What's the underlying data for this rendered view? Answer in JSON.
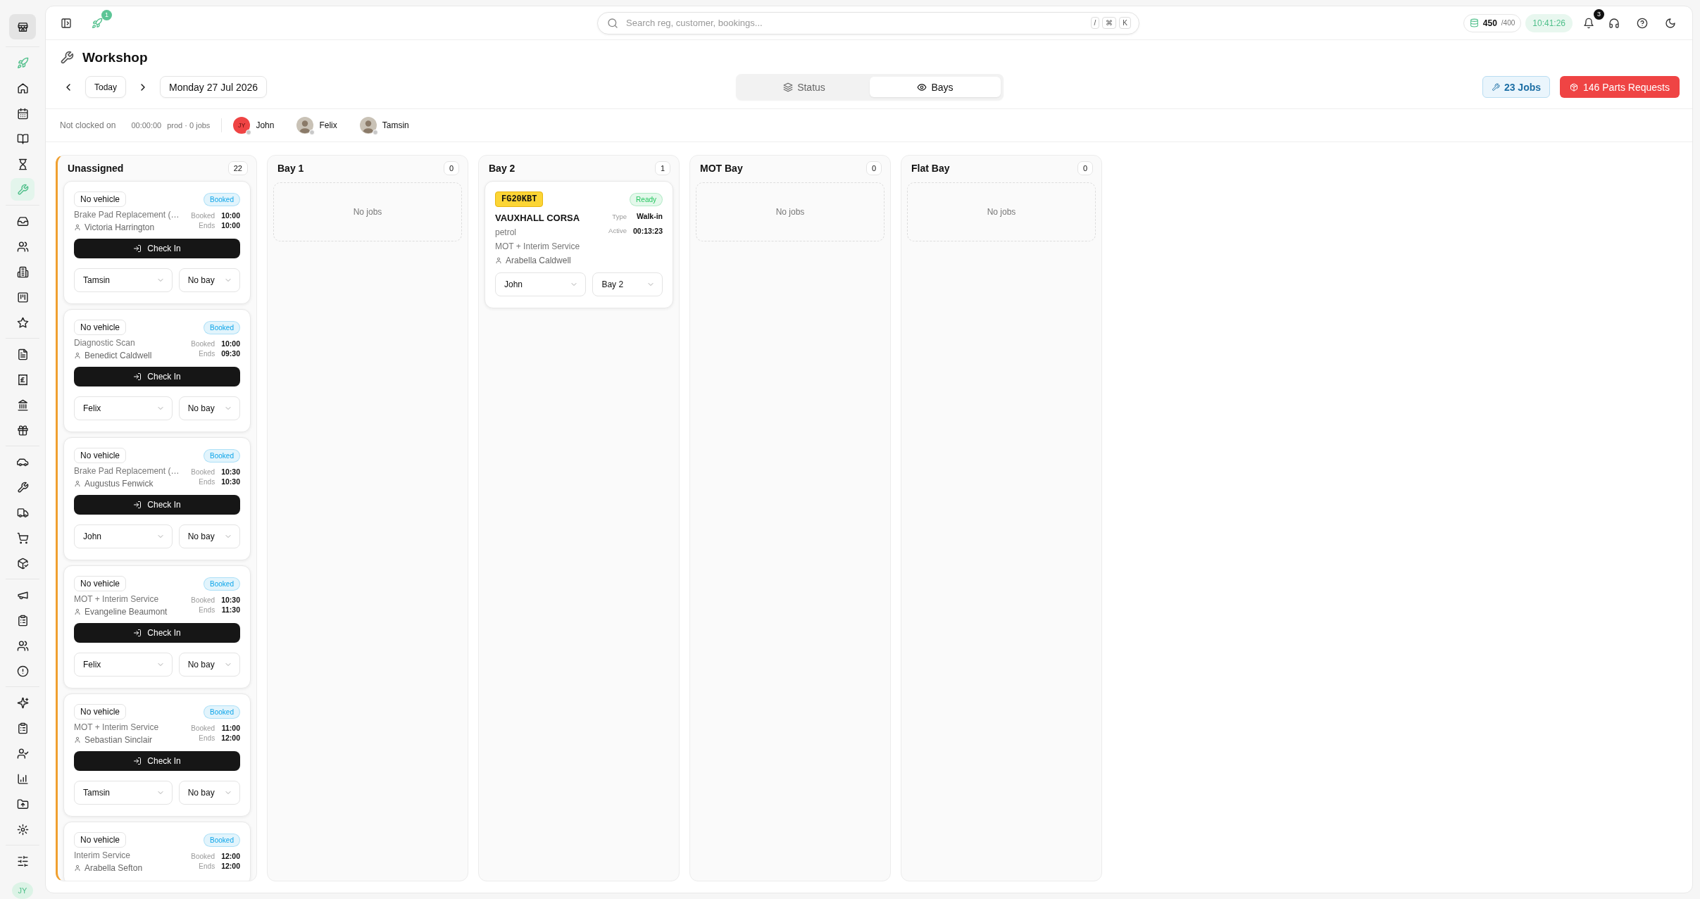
{
  "sidebar": {
    "groups": [
      [
        {
          "selected": false
        }
      ],
      [
        {
          "selected": false
        },
        {
          "selected": false
        },
        {
          "selected": false
        },
        {
          "selected": false
        },
        {
          "selected": false
        },
        {
          "selected": true
        }
      ],
      [
        {
          "selected": false
        },
        {
          "selected": false
        },
        {
          "selected": false
        },
        {
          "selected": false
        },
        {
          "selected": false
        }
      ],
      [
        {
          "selected": false
        },
        {
          "selected": false
        },
        {
          "selected": false
        },
        {
          "selected": false
        }
      ],
      [
        {
          "selected": false
        },
        {
          "selected": false
        },
        {
          "selected": false
        },
        {
          "selected": false
        },
        {
          "selected": false
        }
      ],
      [
        {
          "selected": false
        },
        {
          "selected": false
        },
        {
          "selected": false
        },
        {
          "selected": false
        }
      ],
      [
        {
          "selected": false
        },
        {
          "selected": false
        },
        {
          "selected": false
        },
        {
          "selected": false
        },
        {
          "selected": false
        },
        {
          "selected": false
        }
      ],
      [
        {
          "selected": false
        }
      ]
    ],
    "avatar": "JY"
  },
  "topbar": {
    "launch_badge": "1",
    "search": {
      "placeholder": "Search reg, customer, bookings...",
      "keys": [
        "/",
        "⌘",
        "K"
      ]
    },
    "credits": {
      "value": "450",
      "limit": "/400"
    },
    "clock": "10:41:26",
    "notification_badge": "3"
  },
  "page": {
    "title": "Workshop",
    "today_button": "Today",
    "date": "Monday 27 Jul 2026",
    "view_tabs": [
      {
        "label": "Status",
        "selected": false
      },
      {
        "label": "Bays",
        "selected": true
      }
    ],
    "jobs_button": "23 Jobs",
    "parts_button": "146 Parts Requests"
  },
  "clock_status": {
    "label": "Not clocked on",
    "time": "00:00:00",
    "summary": "prod · 0 jobs"
  },
  "technicians": [
    {
      "name": "John",
      "kind": "initials",
      "initials": "JY",
      "online": false
    },
    {
      "name": "Felix",
      "kind": "photo",
      "online": false
    },
    {
      "name": "Tamsin",
      "kind": "photo",
      "online": false
    }
  ],
  "columns": [
    {
      "title": "Unassigned",
      "count": "22",
      "highlighted": true,
      "jobs": [
        {
          "kind": "booking",
          "vehicle": "No vehicle",
          "status": {
            "label": "Booked",
            "color": "#0ea5e9"
          },
          "service": "Brake Pad Replacement (…",
          "customer": "Victoria Harrington",
          "times": [
            {
              "label": "Booked",
              "value": "10:00"
            },
            {
              "label": "Ends",
              "value": "10:00"
            }
          ],
          "action": "Check In",
          "technician": "Tamsin",
          "bay": "No bay"
        },
        {
          "kind": "booking",
          "vehicle": "No vehicle",
          "status": {
            "label": "Booked",
            "color": "#0ea5e9"
          },
          "service": "Diagnostic Scan",
          "customer": "Benedict Caldwell",
          "times": [
            {
              "label": "Booked",
              "value": "10:00"
            },
            {
              "label": "Ends",
              "value": "09:30"
            }
          ],
          "action": "Check In",
          "technician": "Felix",
          "bay": "No bay"
        },
        {
          "kind": "booking",
          "vehicle": "No vehicle",
          "status": {
            "label": "Booked",
            "color": "#0ea5e9"
          },
          "service": "Brake Pad Replacement (…",
          "customer": "Augustus Fenwick",
          "times": [
            {
              "label": "Booked",
              "value": "10:30"
            },
            {
              "label": "Ends",
              "value": "10:30"
            }
          ],
          "action": "Check In",
          "technician": "John",
          "bay": "No bay"
        },
        {
          "kind": "booking",
          "vehicle": "No vehicle",
          "status": {
            "label": "Booked",
            "color": "#0ea5e9"
          },
          "service": "MOT + Interim Service",
          "customer": "Evangeline Beaumont",
          "times": [
            {
              "label": "Booked",
              "value": "10:30"
            },
            {
              "label": "Ends",
              "value": "11:30"
            }
          ],
          "action": "Check In",
          "technician": "Felix",
          "bay": "No bay"
        },
        {
          "kind": "booking",
          "vehicle": "No vehicle",
          "status": {
            "label": "Booked",
            "color": "#0ea5e9"
          },
          "service": "MOT + Interim Service",
          "customer": "Sebastian Sinclair",
          "times": [
            {
              "label": "Booked",
              "value": "11:00"
            },
            {
              "label": "Ends",
              "value": "12:00"
            }
          ],
          "action": "Check In",
          "technician": "Tamsin",
          "bay": "No bay"
        },
        {
          "kind": "booking",
          "vehicle": "No vehicle",
          "status": {
            "label": "Booked",
            "color": "#0ea5e9"
          },
          "service": "Interim Service",
          "customer": "Arabella Sefton",
          "times": [
            {
              "label": "Booked",
              "value": "12:00"
            },
            {
              "label": "Ends",
              "value": "12:00"
            }
          ]
        }
      ]
    },
    {
      "title": "Bay 1",
      "count": "0",
      "highlighted": false,
      "empty_text": "No jobs"
    },
    {
      "title": "Bay 2",
      "count": "1",
      "highlighted": false,
      "jobs": [
        {
          "kind": "active",
          "reg": "FG20KBT",
          "status": {
            "label": "Ready",
            "color": "#22c55e"
          },
          "vehicle": "VAUXHALL CORSA",
          "fuel": "petrol",
          "service": "MOT + Interim Service",
          "customer": "Arabella Caldwell",
          "times": [
            {
              "label": "Type",
              "value": "Walk-in"
            },
            {
              "label": "Active",
              "value": "00:13:23"
            }
          ],
          "technician": "John",
          "bay": "Bay 2"
        }
      ]
    },
    {
      "title": "MOT Bay",
      "count": "0",
      "highlighted": false,
      "empty_text": "No jobs"
    },
    {
      "title": "Flat Bay",
      "count": "0",
      "highlighted": false,
      "empty_text": "No jobs"
    }
  ]
}
